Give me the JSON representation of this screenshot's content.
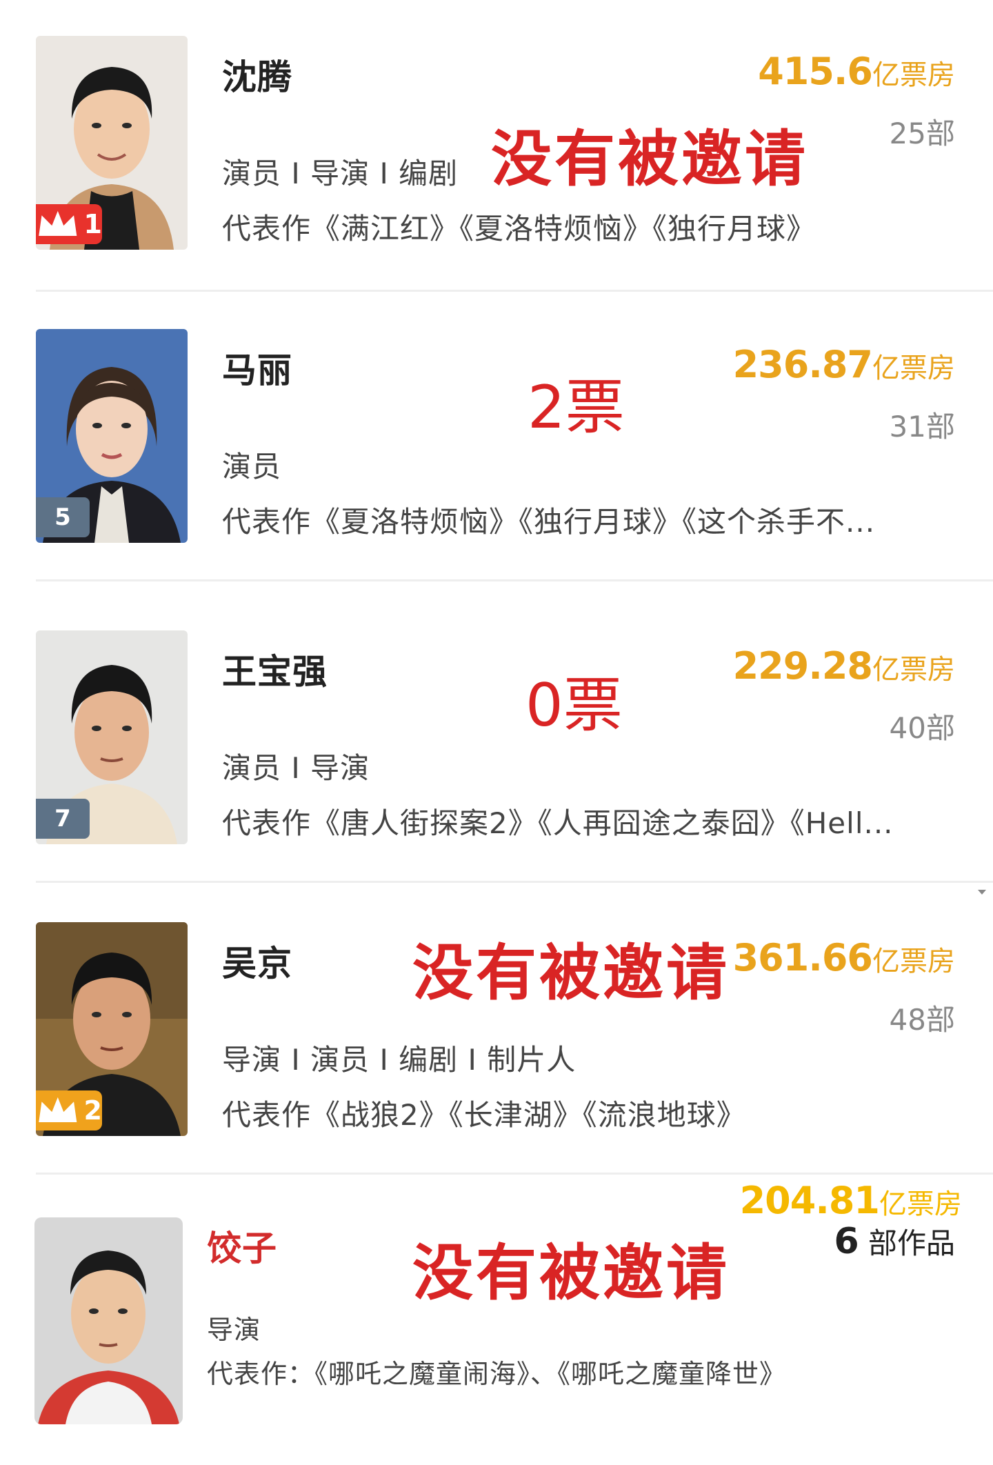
{
  "entries": [
    {
      "name": "沈腾",
      "rank": "1",
      "box_office_number": "415.6",
      "box_office_unit": "亿票房",
      "works_count": "25部",
      "roles": "演员 I 导演 I 编剧",
      "works": "代表作《满江红》《夏洛特烦恼》《独行月球》",
      "overlay": "没有被邀请"
    },
    {
      "name": "马丽",
      "rank": "5",
      "box_office_number": "236.87",
      "box_office_unit": "亿票房",
      "works_count": "31部",
      "roles": "演员",
      "works": "代表作《夏洛特烦恼》《独行月球》《这个杀手不...",
      "overlay": "2票"
    },
    {
      "name": "王宝强",
      "rank": "7",
      "box_office_number": "229.28",
      "box_office_unit": "亿票房",
      "works_count": "40部",
      "roles": "演员 I 导演",
      "works": "代表作《唐人街探案2》《人再囧途之泰囧》《Hell...",
      "overlay": "0票"
    },
    {
      "name": "吴京",
      "rank": "2",
      "box_office_number": "361.66",
      "box_office_unit": "亿票房",
      "works_count": "48部",
      "roles": "导演 I 演员 I 编剧 I 制片人",
      "works": "代表作《战狼2》《长津湖》《流浪地球》",
      "overlay": "没有被邀请"
    },
    {
      "name": "饺子",
      "box_office_number": "204.81",
      "box_office_unit": "亿票房",
      "works_count_number": "6",
      "works_count_unit": "部作品",
      "roles": "导演",
      "works": "代表作：《哪吒之魔童闹海》、《哪吒之魔童降世》",
      "overlay": "没有被邀请"
    }
  ],
  "colors": {
    "box_office": "#e9a31c",
    "box_office_bright": "#f5b800",
    "overlay_red": "#d92424",
    "rank_red": "#e8322c",
    "rank_gold": "#f0a21c",
    "rank_plain": "#5d7287"
  },
  "icons": {
    "crown": "crown-icon"
  }
}
